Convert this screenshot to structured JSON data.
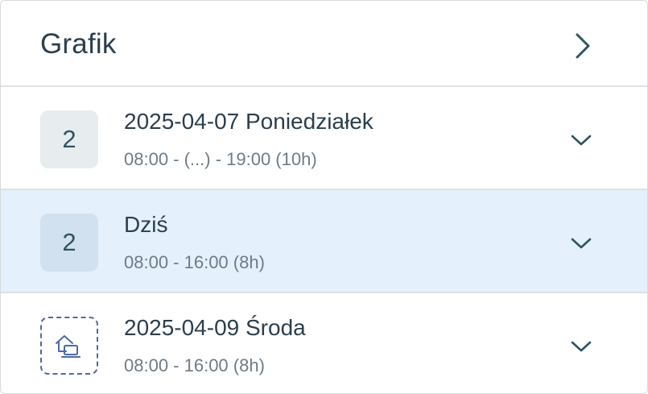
{
  "header": {
    "title": "Grafik",
    "icon": "chevron-right-icon"
  },
  "schedule": [
    {
      "badge": "2",
      "title": "2025-04-07 Poniedziałek",
      "hours": "08:00 - (...) - 19:00 (10h)",
      "highlighted": false,
      "icon": "chevron-down-icon"
    },
    {
      "badge": "2",
      "title": "Dziś",
      "hours": "08:00 - 16:00 (8h)",
      "highlighted": true,
      "icon": "chevron-down-icon"
    },
    {
      "badge_icon": "remote-work-icon",
      "title": "2025-04-09 Środa",
      "hours": "08:00 - 16:00 (8h)",
      "highlighted": false,
      "icon": "chevron-down-icon"
    }
  ],
  "colors": {
    "text": "#2b3f4d",
    "muted": "#6f7b84",
    "highlight": "#e4f0fc",
    "badge": "#e7ecef",
    "accent": "#4a6aa8"
  }
}
